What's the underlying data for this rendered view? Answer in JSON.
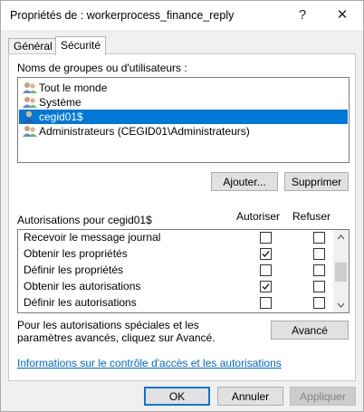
{
  "window": {
    "title": "Propriétés de : workerprocess_finance_reply",
    "help_glyph": "?",
    "close_glyph": "✕"
  },
  "tabs": [
    {
      "label": "Général",
      "active": false
    },
    {
      "label": "Sécurité",
      "active": true
    }
  ],
  "groups": {
    "label": "Noms de groupes ou d'utilisateurs :",
    "items": [
      {
        "name": "Tout le monde",
        "icon": "users-group-icon",
        "selected": false
      },
      {
        "name": "Système",
        "icon": "users-group-icon",
        "selected": false
      },
      {
        "name": "cegid01$",
        "icon": "user-icon",
        "selected": true
      },
      {
        "name": "Administrateurs (CEGID01\\Administrateurs)",
        "icon": "users-group-icon",
        "selected": false
      }
    ],
    "add_label": "Ajouter...",
    "remove_label": "Supprimer"
  },
  "permissions": {
    "label": "Autorisations pour cegid01$",
    "allow_header": "Autoriser",
    "deny_header": "Refuser",
    "rows": [
      {
        "name": "Recevoir le message journal",
        "allow": false,
        "deny": false
      },
      {
        "name": "Obtenir les propriétés",
        "allow": true,
        "deny": false
      },
      {
        "name": "Définir les propriétés",
        "allow": false,
        "deny": false
      },
      {
        "name": "Obtenir les autorisations",
        "allow": true,
        "deny": false
      },
      {
        "name": "Définir les autorisations",
        "allow": false,
        "deny": false
      }
    ]
  },
  "advanced": {
    "text": "Pour les autorisations spéciales et les paramètres avancés, cliquez sur Avancé.",
    "button_label": "Avancé"
  },
  "link_text": "Informations sur le contrôle d'accès et les autorisations",
  "footer": {
    "ok_label": "OK",
    "cancel_label": "Annuler",
    "apply_label": "Appliquer"
  },
  "colors": {
    "selection": "#0078d7",
    "link": "#0066cc"
  }
}
